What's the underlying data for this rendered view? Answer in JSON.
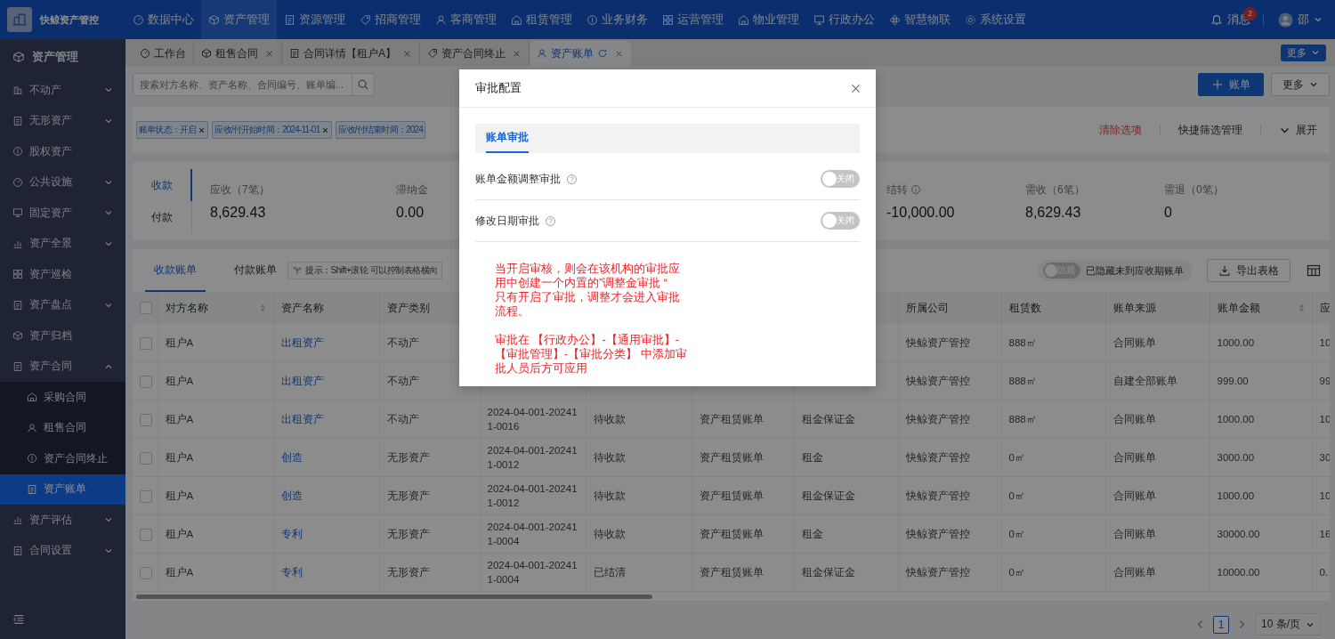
{
  "app": {
    "name": "快鲸资产管控"
  },
  "top_nav": [
    {
      "label": "数据中心",
      "selected": false
    },
    {
      "label": "资产管理",
      "selected": true
    },
    {
      "label": "资源管理",
      "selected": false
    },
    {
      "label": "招商管理",
      "selected": false
    },
    {
      "label": "客商管理",
      "selected": false
    },
    {
      "label": "租赁管理",
      "selected": false
    },
    {
      "label": "业务财务",
      "selected": false
    },
    {
      "label": "运营管理",
      "selected": false
    },
    {
      "label": "物业管理",
      "selected": false
    },
    {
      "label": "行政办公",
      "selected": false
    },
    {
      "label": "智慧物联",
      "selected": false
    },
    {
      "label": "系统设置",
      "selected": false
    }
  ],
  "notifications": {
    "label": "消息",
    "badge": "2"
  },
  "user": {
    "name": "邵"
  },
  "sidebar": {
    "title": "资产管理",
    "items": [
      {
        "label": "不动产",
        "kind": "group",
        "expanded": false,
        "selected": false
      },
      {
        "label": "无形资产",
        "kind": "group",
        "expanded": false,
        "selected": false
      },
      {
        "label": "股权资产",
        "kind": "link",
        "selected": false
      },
      {
        "label": "公共设施",
        "kind": "group",
        "expanded": false,
        "selected": false
      },
      {
        "label": "固定资产",
        "kind": "group",
        "expanded": false,
        "selected": false
      },
      {
        "label": "资产全景",
        "kind": "group",
        "expanded": false,
        "selected": false
      },
      {
        "label": "资产巡检",
        "kind": "link",
        "selected": false
      },
      {
        "label": "资产盘点",
        "kind": "group",
        "expanded": false,
        "selected": false
      },
      {
        "label": "资产归档",
        "kind": "link",
        "selected": false
      },
      {
        "label": "资产合同",
        "kind": "group",
        "expanded": true,
        "selected": false,
        "children": [
          {
            "label": "采购合同",
            "selected": false
          },
          {
            "label": "租售合同",
            "selected": false
          },
          {
            "label": "资产合同终止",
            "selected": false
          },
          {
            "label": "资产账单",
            "selected": true
          }
        ]
      },
      {
        "label": "资产评估",
        "kind": "group",
        "expanded": false,
        "selected": false
      },
      {
        "label": "合同设置",
        "kind": "group",
        "expanded": false,
        "selected": false
      }
    ]
  },
  "page_tabs": [
    {
      "label": "工作台",
      "closable": false,
      "refreshable": false,
      "selected": false
    },
    {
      "label": "租售合同",
      "closable": true,
      "refreshable": false,
      "selected": false
    },
    {
      "label": "合同详情【租户A】",
      "closable": true,
      "refreshable": false,
      "selected": false
    },
    {
      "label": "资产合同终止",
      "closable": true,
      "refreshable": false,
      "selected": false
    },
    {
      "label": "资产账单",
      "closable": true,
      "refreshable": true,
      "selected": true
    }
  ],
  "page_tabs_more": "更多",
  "search": {
    "placeholder": "搜索对方名称、资产名称、合同编号、账单编..."
  },
  "actions": {
    "add": "账单",
    "more": "更多"
  },
  "filters": {
    "tags": [
      {
        "label": "账单状态：开启",
        "closable": true
      },
      {
        "label": "应收/付开始时间：2024-11-01",
        "closable": true
      },
      {
        "label": "应收/付结束时间：2024",
        "closable": false
      }
    ],
    "clear": "清除选项",
    "manage": "快捷筛选管理",
    "expand": "展开"
  },
  "stats": {
    "modes": [
      {
        "label": "收款",
        "selected": true
      },
      {
        "label": "付款",
        "selected": false
      }
    ],
    "left": [
      {
        "label": "应收（7笔）",
        "value": "8,629.43",
        "info": false
      },
      {
        "label": "滞纳金",
        "value": "0.00",
        "info": false
      }
    ],
    "right": [
      {
        "label": "结转",
        "value": "-10,000.00",
        "info": true
      },
      {
        "label": "需收（6笔）",
        "value": "8,629.43",
        "info": false
      },
      {
        "label": "需退（0笔）",
        "value": "0",
        "info": false
      }
    ]
  },
  "bill_tabs": [
    {
      "label": "收款账单",
      "selected": true
    },
    {
      "label": "付款账单",
      "selected": false
    }
  ],
  "hint": "提示：Shift+滚轮 可以控制表格横向",
  "hide_toggle": {
    "label": "隐藏",
    "on": false,
    "caption": "已隐藏未到应收期账单"
  },
  "export": "导出表格",
  "table": {
    "all_checked": false,
    "columns": [
      {
        "label": "对方名称",
        "sortable": true,
        "kind": "text"
      },
      {
        "label": "资产名称",
        "sortable": false,
        "kind": "link"
      },
      {
        "label": "资产类别",
        "kind": "text"
      },
      null,
      null,
      null,
      null,
      {
        "label": "所属公司",
        "sortable": false,
        "kind": "text"
      },
      {
        "label": "租赁数",
        "sortable": false,
        "kind": "text"
      },
      {
        "label": "账单来源",
        "sortable": false,
        "kind": "text"
      },
      {
        "label": "账单金额",
        "sortable": true,
        "kind": "text"
      },
      {
        "label": "应",
        "kind": "text"
      }
    ],
    "rows": [
      {
        "checked": false,
        "cells": [
          "租户A",
          "出租资产",
          "不动产",
          null,
          null,
          null,
          null,
          "快鲸资产管控",
          "888㎡",
          "合同账单",
          "1000.00",
          "10"
        ]
      },
      {
        "checked": false,
        "cells": [
          "租户A",
          "出租资产",
          "不动产",
          null,
          null,
          null,
          null,
          "快鲸资产管控",
          "888㎡",
          "自建全部账单",
          "999.00",
          "99"
        ]
      },
      {
        "checked": false,
        "cells": [
          "租户A",
          "出租资产",
          "不动产",
          "2024-04-001-202411-0016",
          "待收款",
          "资产租赁账单",
          "租金保证金",
          "快鲸资产管控",
          "888㎡",
          "合同账单",
          "1000.00",
          "10"
        ]
      },
      {
        "checked": false,
        "cells": [
          "租户A",
          "创造",
          "无形资产",
          "2024-04-001-202411-0012",
          "待收款",
          "资产租赁账单",
          "租金",
          "快鲸资产管控",
          "0㎡",
          "合同账单",
          "3000.00",
          "30"
        ]
      },
      {
        "checked": false,
        "cells": [
          "租户A",
          "创造",
          "无形资产",
          "2024-04-001-202411-0012",
          "待收款",
          "资产租赁账单",
          "租金保证金",
          "快鲸资产管控",
          "0㎡",
          "合同账单",
          "1000.00",
          "10"
        ]
      },
      {
        "checked": false,
        "cells": [
          "租户A",
          "专利",
          "无形资产",
          "2024-04-001-202411-0004",
          "待收款",
          "资产租赁账单",
          "租金",
          "快鲸资产管控",
          "0㎡",
          "合同账单",
          "30000.00",
          "16"
        ]
      },
      {
        "checked": false,
        "cells": [
          "租户A",
          "专利",
          "无形资产",
          "2024-04-001-202411-0004",
          "已结清",
          "资产租赁账单",
          "租金保证金",
          "快鲸资产管控",
          "0㎡",
          "合同账单",
          "10000.00",
          "0."
        ]
      }
    ]
  },
  "pagination": {
    "pages": [
      {
        "label": "1",
        "selected": true
      }
    ],
    "page_size": "10 条/页"
  },
  "modal": {
    "title": "审批配置",
    "tabs": [
      {
        "label": "账单审批",
        "selected": true
      }
    ],
    "settings": [
      {
        "label": "账单金额调整审批",
        "on": false,
        "state_text": "关闭"
      },
      {
        "label": "修改日期审批",
        "on": false,
        "state_text": "关闭"
      }
    ],
    "note": [
      [
        "当开启审核，则会在该机构的审批应用中创建一个内置的”调整金审批 “",
        "只有开启了审批，调整才会进入审批流程。"
      ],
      [
        "审批在 【行政办公】-【通用审批】-【审批管理】-【审批分类】 中添加审批人员后方可应用"
      ]
    ]
  }
}
